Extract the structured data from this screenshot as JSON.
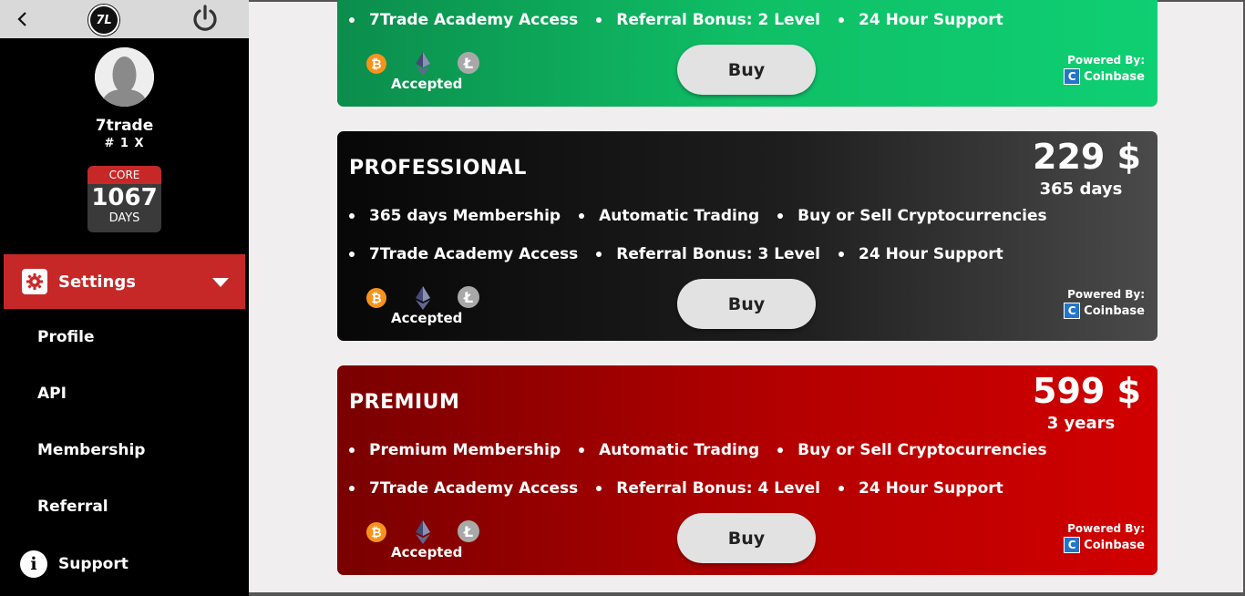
{
  "sidebar": {
    "username": "7trade",
    "rank": "# 1 X",
    "badge": {
      "core": "CORE",
      "days": "1067",
      "days_label": "DAYS"
    },
    "settings_label": "Settings",
    "menu": [
      "Profile",
      "API",
      "Membership",
      "Referral"
    ],
    "support_label": "Support",
    "logo_text": "7L"
  },
  "plans": [
    {
      "title": "",
      "price": "",
      "period": "",
      "row1": [],
      "row2": [
        "7Trade Academy Access",
        "Referral Bonus: 2 Level",
        "24 Hour Support"
      ],
      "accepted": "Accepted",
      "buy": "Buy",
      "powered": "Powered By:",
      "coinbase": "Coinbase"
    },
    {
      "title": "PROFESSIONAL",
      "price": "229 $",
      "period": "365 days",
      "row1": [
        "365 days Membership",
        "Automatic Trading",
        "Buy or Sell Cryptocurrencies"
      ],
      "row2": [
        "7Trade Academy Access",
        "Referral Bonus: 3 Level",
        "24 Hour Support"
      ],
      "accepted": "Accepted",
      "buy": "Buy",
      "powered": "Powered By:",
      "coinbase": "Coinbase"
    },
    {
      "title": "PREMIUM",
      "price": "599 $",
      "period": "3 years",
      "row1": [
        "Premium Membership",
        "Automatic Trading",
        "Buy or Sell Cryptocurrencies"
      ],
      "row2": [
        "7Trade Academy Access",
        "Referral Bonus: 4 Level",
        "24 Hour Support"
      ],
      "accepted": "Accepted",
      "buy": "Buy",
      "powered": "Powered By:",
      "coinbase": "Coinbase"
    }
  ],
  "icons": {
    "back": "chevron-left-icon",
    "power": "power-icon",
    "gear": "gear-icon",
    "info": "info-icon",
    "btc": "bitcoin-icon",
    "eth": "ethereum-icon",
    "ltc": "litecoin-icon"
  },
  "colors": {
    "accent_red": "#c62828",
    "basic_green": "#0fbf66",
    "pro_dark": "#1e1e1e",
    "premium_red": "#b40000"
  }
}
